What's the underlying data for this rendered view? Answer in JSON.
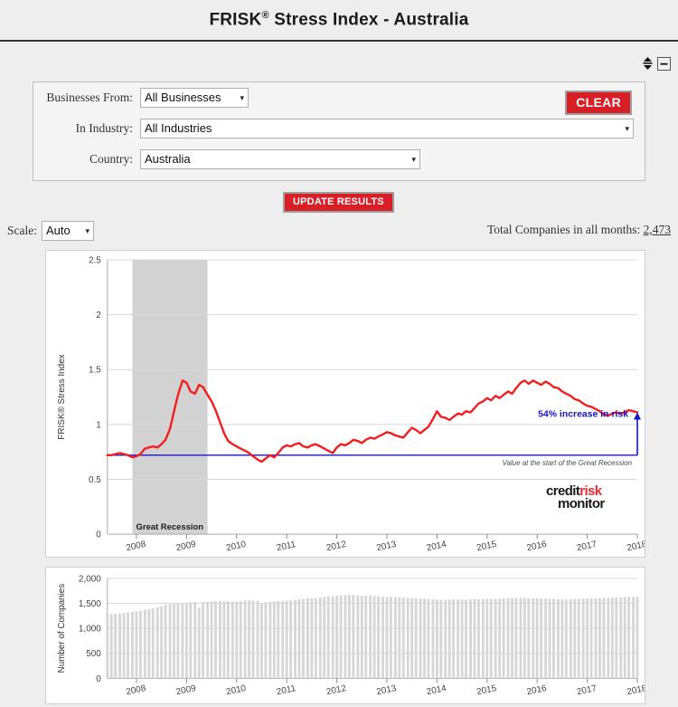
{
  "header": {
    "title_main": "FRISK",
    "title_sup": "®",
    "title_rest": " Stress Index - Australia"
  },
  "window_controls": {
    "resize_label": "resize",
    "collapse_label": "collapse"
  },
  "filters": {
    "businesses_label": "Businesses From:",
    "businesses_value": "All Businesses",
    "industry_label": "In Industry:",
    "industry_value": "All Industries",
    "country_label": "Country:",
    "country_value": "Australia",
    "clear_label": "CLEAR",
    "caret": "▾"
  },
  "actions": {
    "update_label": "UPDATE RESULTS"
  },
  "scale": {
    "label": "Scale:",
    "value": "Auto",
    "caret": "▾"
  },
  "summary": {
    "total_label": "Total Companies in all months:",
    "total_value": "2,473"
  },
  "logo": {
    "line1_a": "credit",
    "line1_b": "risk",
    "line2": "monitor"
  },
  "chart_data": [
    {
      "id": "stress-index",
      "type": "line",
      "title": "",
      "xlabel": "",
      "ylabel": "FRISK® Stress Index",
      "ylim": [
        0,
        2.5
      ],
      "yticks": [
        0,
        0.5,
        1,
        1.5,
        2,
        2.5
      ],
      "ytick_labels": [
        "0",
        "0.5",
        "1",
        "1.5",
        "2",
        "2.5"
      ],
      "xlim": [
        2007.42,
        2018.0
      ],
      "xticks": [
        2008,
        2009,
        2010,
        2011,
        2012,
        2013,
        2014,
        2015,
        2016,
        2017,
        2018
      ],
      "xtick_labels": [
        "2008",
        "2009",
        "2010",
        "2011",
        "2012",
        "2013",
        "2014",
        "2015",
        "2016",
        "2017",
        "2018"
      ],
      "grid": true,
      "legend": "none",
      "series": [
        {
          "name": "FRISK Stress Index",
          "color": "#f41d1d",
          "x": [
            2007.42,
            2007.5,
            2007.58,
            2007.67,
            2007.75,
            2007.83,
            2007.92,
            2008.0,
            2008.08,
            2008.17,
            2008.25,
            2008.33,
            2008.42,
            2008.5,
            2008.58,
            2008.67,
            2008.75,
            2008.83,
            2008.92,
            2009.0,
            2009.08,
            2009.17,
            2009.25,
            2009.33,
            2009.42,
            2009.5,
            2009.58,
            2009.67,
            2009.75,
            2009.83,
            2009.92,
            2010.0,
            2010.08,
            2010.17,
            2010.25,
            2010.33,
            2010.42,
            2010.5,
            2010.58,
            2010.67,
            2010.75,
            2010.83,
            2010.92,
            2011.0,
            2011.08,
            2011.17,
            2011.25,
            2011.33,
            2011.42,
            2011.5,
            2011.58,
            2011.67,
            2011.75,
            2011.83,
            2011.92,
            2012.0,
            2012.08,
            2012.17,
            2012.25,
            2012.33,
            2012.42,
            2012.5,
            2012.58,
            2012.67,
            2012.75,
            2012.83,
            2012.92,
            2013.0,
            2013.08,
            2013.17,
            2013.25,
            2013.33,
            2013.42,
            2013.5,
            2013.58,
            2013.67,
            2013.75,
            2013.83,
            2013.92,
            2014.0,
            2014.08,
            2014.17,
            2014.25,
            2014.33,
            2014.42,
            2014.5,
            2014.58,
            2014.67,
            2014.75,
            2014.83,
            2014.92,
            2015.0,
            2015.08,
            2015.17,
            2015.25,
            2015.33,
            2015.42,
            2015.5,
            2015.58,
            2015.67,
            2015.75,
            2015.83,
            2015.92,
            2016.0,
            2016.08,
            2016.17,
            2016.25,
            2016.33,
            2016.42,
            2016.5,
            2016.58,
            2016.67,
            2016.75,
            2016.83,
            2016.92,
            2017.0,
            2017.08,
            2017.17,
            2017.25,
            2017.33,
            2017.42,
            2017.5,
            2017.58,
            2017.67,
            2017.75,
            2017.83,
            2017.92,
            2018.0
          ],
          "y": [
            0.72,
            0.72,
            0.73,
            0.74,
            0.73,
            0.72,
            0.7,
            0.71,
            0.73,
            0.78,
            0.79,
            0.8,
            0.79,
            0.82,
            0.86,
            0.96,
            1.12,
            1.27,
            1.4,
            1.38,
            1.3,
            1.28,
            1.36,
            1.34,
            1.27,
            1.21,
            1.13,
            1.02,
            0.92,
            0.85,
            0.82,
            0.8,
            0.78,
            0.76,
            0.74,
            0.71,
            0.68,
            0.66,
            0.69,
            0.72,
            0.7,
            0.74,
            0.79,
            0.81,
            0.8,
            0.82,
            0.83,
            0.8,
            0.79,
            0.81,
            0.82,
            0.8,
            0.78,
            0.76,
            0.74,
            0.79,
            0.82,
            0.81,
            0.83,
            0.86,
            0.85,
            0.83,
            0.86,
            0.88,
            0.87,
            0.89,
            0.91,
            0.93,
            0.92,
            0.9,
            0.89,
            0.88,
            0.93,
            0.97,
            0.95,
            0.92,
            0.95,
            0.98,
            1.05,
            1.12,
            1.07,
            1.06,
            1.04,
            1.07,
            1.1,
            1.09,
            1.12,
            1.11,
            1.15,
            1.19,
            1.21,
            1.24,
            1.22,
            1.26,
            1.24,
            1.27,
            1.3,
            1.28,
            1.33,
            1.38,
            1.4,
            1.37,
            1.4,
            1.38,
            1.36,
            1.39,
            1.37,
            1.34,
            1.33,
            1.3,
            1.28,
            1.26,
            1.23,
            1.22,
            1.19,
            1.17,
            1.16,
            1.14,
            1.12,
            1.09,
            1.08,
            1.1,
            1.11,
            1.1,
            1.11,
            1.13,
            1.12,
            1.11
          ]
        }
      ],
      "annotations": {
        "recession_label": "Great Recession",
        "recession_start": 2007.92,
        "recession_end": 2009.42,
        "baseline_value": 0.72,
        "baseline_label": "Value at the start of the Great Recession",
        "increase_label": "54% increase in risk",
        "arrow_x": 2018.0,
        "arrow_top": 1.11
      }
    },
    {
      "id": "number-of-companies",
      "type": "bar",
      "ylabel": "Number of Companies",
      "xlabel": "",
      "ylim": [
        0,
        2000
      ],
      "yticks": [
        0,
        500,
        1000,
        1500,
        2000
      ],
      "ytick_labels": [
        "0",
        "500",
        "1,000",
        "1,500",
        "2,000"
      ],
      "xlim": [
        2007.42,
        2018.0
      ],
      "xticks": [
        2008,
        2009,
        2010,
        2011,
        2012,
        2013,
        2014,
        2015,
        2016,
        2017,
        2018
      ],
      "xtick_labels": [
        "2008",
        "2009",
        "2010",
        "2011",
        "2012",
        "2013",
        "2014",
        "2015",
        "2016",
        "2017",
        "2018"
      ],
      "grid": true,
      "bar_color": "#d6d6d6",
      "x": [
        2007.42,
        2007.5,
        2007.58,
        2007.67,
        2007.75,
        2007.83,
        2007.92,
        2008.0,
        2008.08,
        2008.17,
        2008.25,
        2008.33,
        2008.42,
        2008.5,
        2008.58,
        2008.67,
        2008.75,
        2008.83,
        2008.92,
        2009.0,
        2009.08,
        2009.17,
        2009.25,
        2009.33,
        2009.42,
        2009.5,
        2009.58,
        2009.67,
        2009.75,
        2009.83,
        2009.92,
        2010.0,
        2010.08,
        2010.17,
        2010.25,
        2010.33,
        2010.42,
        2010.5,
        2010.58,
        2010.67,
        2010.75,
        2010.83,
        2010.92,
        2011.0,
        2011.08,
        2011.17,
        2011.25,
        2011.33,
        2011.42,
        2011.5,
        2011.58,
        2011.67,
        2011.75,
        2011.83,
        2011.92,
        2012.0,
        2012.08,
        2012.17,
        2012.25,
        2012.33,
        2012.42,
        2012.5,
        2012.58,
        2012.67,
        2012.75,
        2012.83,
        2012.92,
        2013.0,
        2013.08,
        2013.17,
        2013.25,
        2013.33,
        2013.42,
        2013.5,
        2013.58,
        2013.67,
        2013.75,
        2013.83,
        2013.92,
        2014.0,
        2014.08,
        2014.17,
        2014.25,
        2014.33,
        2014.42,
        2014.5,
        2014.58,
        2014.67,
        2014.75,
        2014.83,
        2014.92,
        2015.0,
        2015.08,
        2015.17,
        2015.25,
        2015.33,
        2015.42,
        2015.5,
        2015.58,
        2015.67,
        2015.75,
        2015.83,
        2015.92,
        2016.0,
        2016.08,
        2016.17,
        2016.25,
        2016.33,
        2016.42,
        2016.5,
        2016.58,
        2016.67,
        2016.75,
        2016.83,
        2016.92,
        2017.0,
        2017.08,
        2017.17,
        2017.25,
        2017.33,
        2017.42,
        2017.5,
        2017.58,
        2017.67,
        2017.75,
        2017.83,
        2017.92,
        2018.0
      ],
      "values": [
        1300,
        1285,
        1290,
        1300,
        1310,
        1320,
        1330,
        1340,
        1350,
        1375,
        1385,
        1400,
        1420,
        1440,
        1470,
        1480,
        1485,
        1490,
        1495,
        1510,
        1520,
        1530,
        1415,
        1525,
        1535,
        1540,
        1545,
        1545,
        1550,
        1545,
        1540,
        1535,
        1545,
        1560,
        1565,
        1555,
        1550,
        1505,
        1515,
        1530,
        1540,
        1545,
        1550,
        1555,
        1560,
        1570,
        1580,
        1590,
        1600,
        1605,
        1610,
        1615,
        1625,
        1635,
        1640,
        1655,
        1660,
        1665,
        1670,
        1665,
        1660,
        1650,
        1655,
        1660,
        1650,
        1640,
        1630,
        1625,
        1630,
        1625,
        1620,
        1615,
        1610,
        1605,
        1600,
        1595,
        1590,
        1585,
        1580,
        1575,
        1570,
        1570,
        1575,
        1580,
        1578,
        1576,
        1574,
        1578,
        1582,
        1580,
        1585,
        1588,
        1590,
        1592,
        1594,
        1596,
        1600,
        1605,
        1610,
        1608,
        1606,
        1604,
        1602,
        1600,
        1598,
        1596,
        1594,
        1590,
        1585,
        1580,
        1578,
        1582,
        1586,
        1590,
        1594,
        1596,
        1600,
        1602,
        1606,
        1610,
        1612,
        1615,
        1618,
        1622,
        1626,
        1630,
        1628,
        1625
      ]
    }
  ]
}
